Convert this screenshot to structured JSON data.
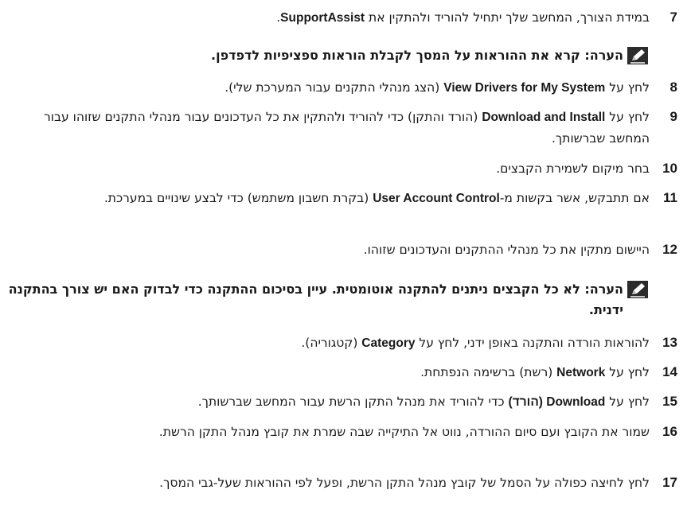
{
  "steps": [
    {
      "num": "7",
      "p1": "במידת הצורך, המחשב שלך יתחיל להוריד ולהתקין את ",
      "b1": "SupportAssist",
      "p2": "."
    },
    {
      "num": "8",
      "p1": "לחץ על ",
      "b1": "View Drivers for My System",
      "p2": " (הצג מנהלי התקנים עבור המערכת שלי)."
    },
    {
      "num": "9",
      "p1": "לחץ על ",
      "b1": "Download and Install",
      "p2": " (הורד והתקן) כדי להוריד ולהתקין את כל העדכונים עבור מנהלי התקנים שזוהו עבור המחשב שברשותך."
    },
    {
      "num": "10",
      "p1": "בחר מיקום לשמירת הקבצים.",
      "b1": "",
      "p2": ""
    },
    {
      "num": "11",
      "p1": "אם תתבקש, אשר בקשות מ-",
      "b1": "User Account Control",
      "p2": " (בקרת חשבון משתמש) כדי לבצע שינויים במערכת."
    },
    {
      "num": "12",
      "p1": "היישום מתקין את כל מנהלי ההתקנים והעדכונים שזוהו.",
      "b1": "",
      "p2": ""
    },
    {
      "num": "13",
      "p1": "להוראות הורדה והתקנה באופן ידני, לחץ על ",
      "b1": "Category",
      "p2": " (קטגוריה)."
    },
    {
      "num": "14",
      "p1": "לחץ על ",
      "b1": "Network",
      "p2": " (רשת) ברשימה הנפתחת."
    },
    {
      "num": "15",
      "p1": "לחץ על ",
      "b1": "Download (הורד)",
      "p2": " כדי להוריד את מנהל התקן הרשת עבור המחשב שברשותך."
    },
    {
      "num": "16",
      "p1": "שמור את הקובץ ועם סיום ההורדה, נווט אל התיקייה שבה שמרת את קובץ מנהל התקן הרשת.",
      "b1": "",
      "p2": ""
    },
    {
      "num": "17",
      "p1": "לחץ לחיצה כפולה על הסמל של קובץ מנהל התקן הרשת, ופעל לפי ההוראות שעל-גבי המסך.",
      "b1": "",
      "p2": ""
    }
  ],
  "notes": [
    {
      "text": "הערה: קרא את ההוראות על המסך לקבלת הוראות ספציפיות לדפדפן."
    },
    {
      "text": "הערה: לא כל הקבצים ניתנים להתקנה אוטומטית. עיין בסיכום ההתקנה כדי לבדוק האם יש צורך בהתקנה ידנית."
    }
  ]
}
